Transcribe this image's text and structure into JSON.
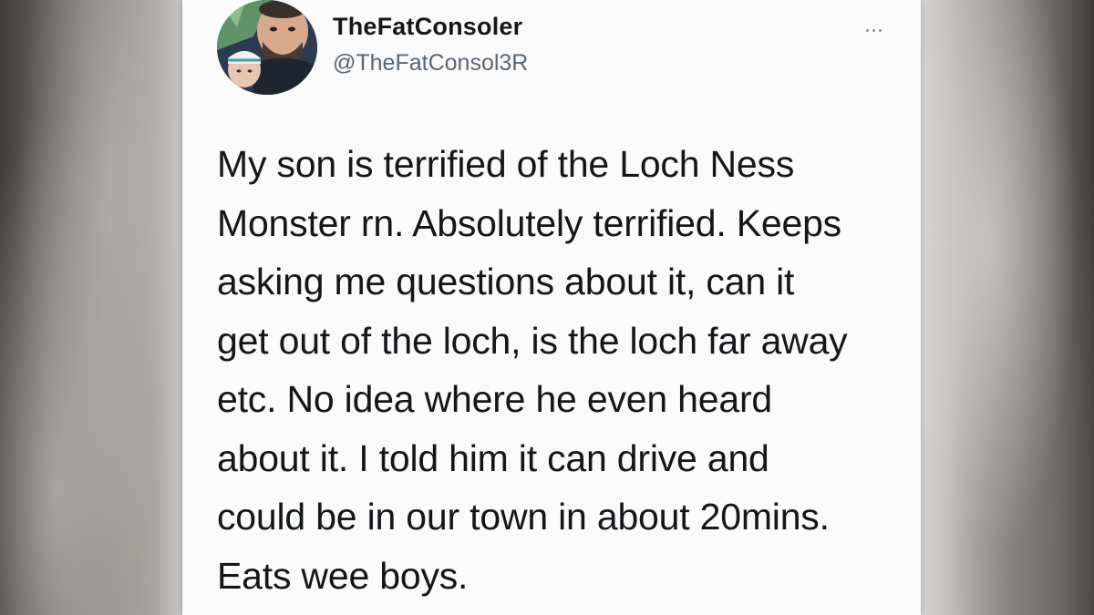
{
  "tweet": {
    "author": {
      "display_name": "TheFatConsoler",
      "handle": "@TheFatConsol3R",
      "avatar_icon": "profile-photo"
    },
    "more_icon": "more-options-icon",
    "text_lines": [
      "My son is terrified of the Loch Ness",
      "Monster rn. Absolutely terrified. Keeps",
      "asking me questions about it, can it",
      "get out of the loch, is the loch far away",
      "etc. No idea where he even heard",
      "about it. I told him it can drive and",
      "could be in our town in about 20mins.",
      "Eats wee boys."
    ]
  },
  "colors": {
    "card_background": "#fafafa",
    "text_primary": "#14171a",
    "text_secondary": "#5b6670"
  }
}
